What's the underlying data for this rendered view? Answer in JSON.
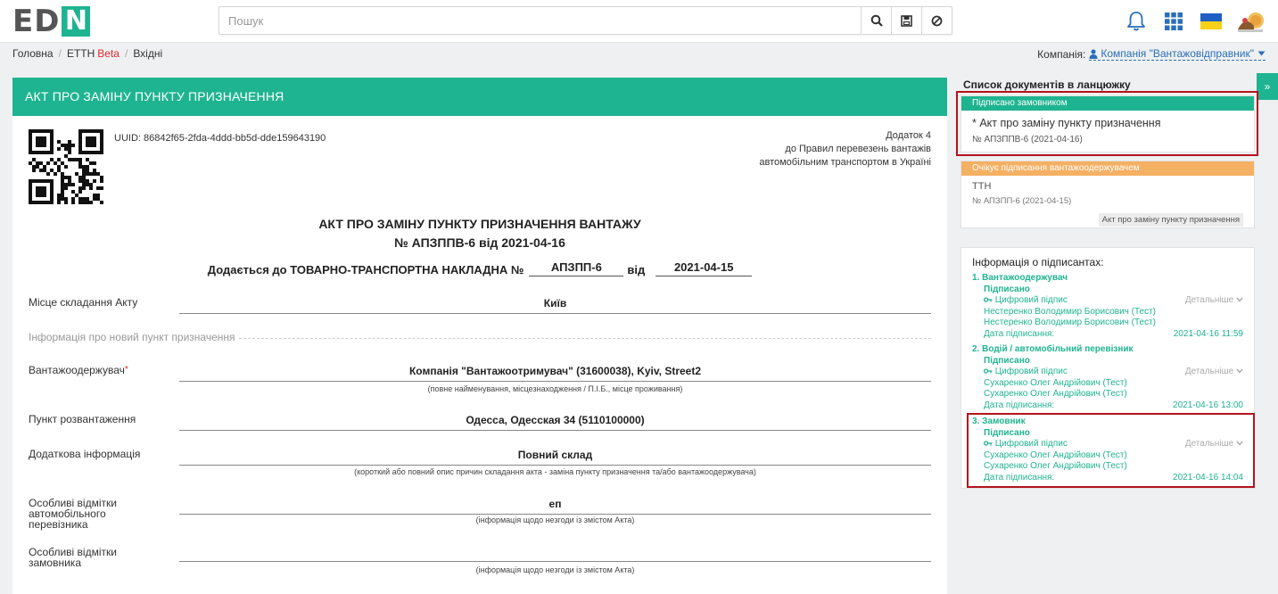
{
  "header": {
    "logo_text": "ED",
    "logo_accent_letter": "N",
    "search_placeholder": "Пошук",
    "icons": [
      "search-icon",
      "save-icon",
      "cancel-icon",
      "bell-icon",
      "apps-grid-icon",
      "ukraine-flag-icon",
      "user-avatar-icon"
    ]
  },
  "breadcrumbs": {
    "home": "Головна",
    "etth": "ЕТТН",
    "beta": "Beta",
    "inbox": "Вхідні"
  },
  "company": {
    "label": "Компанія:",
    "value": "Компанія \"Вантажовідправник\""
  },
  "document": {
    "header_title": "АКТ ПРО ЗАМІНУ ПУНКТУ ПРИЗНАЧЕННЯ",
    "uuid": "UUID: 86842f65-2fda-4ddd-bb5d-dde159643190",
    "addendum": [
      "Додаток 4",
      "до Правил перевезень вантажів",
      "автомобільним транспортом в Україні"
    ],
    "title_line1": "АКТ ПРО ЗАМІНУ ПУНКТУ ПРИЗНАЧЕННЯ ВАНТАЖУ",
    "title_line2": "№ АПЗППВ-6 від 2021-04-16",
    "attach_prefix": "Додається до ТОВАРНО-ТРАНСПОРТНА НАКЛАДНА №",
    "attach_number": "АПЗПП-6",
    "attach_from": "від",
    "attach_date": "2021-04-15",
    "fields": {
      "place_label": "Місце складання Акту",
      "place_value": "Київ",
      "section_new_point": "Інформація про новий пункт призначення",
      "consignee_label": "Вантажоодержувач",
      "consignee_required": "*",
      "consignee_value": "Компанія \"Вантажоотримувач\" (31600038), Kyiv, Street2",
      "consignee_hint": "(повне найменування, місцезнаходження / П.І.Б., місце проживання)",
      "unload_label": "Пункт розвантаження",
      "unload_value": "Одесса, Одесская 34 (5110100000)",
      "extra_label": "Додаткова інформація",
      "extra_value": "Повний склад",
      "extra_hint": "(короткий або повний опис причин складання акта - заміна пункту призначення та/або вантажоодержувача)",
      "carrier_marks_label": "Особливі відмітки автомобільного перевізника",
      "carrier_marks_value": "еп",
      "carrier_marks_hint": "(інформація щодо незгоди із змістом Акта)",
      "customer_marks_label": "Особливі відмітки замовника",
      "customer_marks_value": "",
      "customer_marks_hint": "(інформація щодо незгоди із змістом Акта)"
    }
  },
  "chain": {
    "title": "Список документів в ланцюжку",
    "toggle": "»",
    "items": [
      {
        "status": "Підписано замовником",
        "status_color": "#1fb491",
        "name": "* Акт про заміну пункту призначення",
        "number": "№ АПЗППВ-6 (2021-04-16)",
        "tag": ""
      },
      {
        "status": "Очікує підписання вантажоодержувачем",
        "status_color": "#f4b063",
        "name": "ТТН",
        "number": "№ АПЗПП-6 (2021-04-15)",
        "tag": "Акт про заміну пункту призначення"
      }
    ]
  },
  "signers": {
    "title": "Інформація о підписантах:",
    "list": [
      {
        "num": "1.",
        "role": "Вантажоодержувач",
        "status": "Підписано",
        "sig_type": "Цифровий підпис",
        "details": "Детальніше",
        "name1": "Нестеренко Володимир Борисович (Тест)",
        "name2": "Нестеренко Володимир Борисович (Тест)",
        "date_label": "Дата підписання:",
        "date_value": "2021-04-16 11:59"
      },
      {
        "num": "2.",
        "role": "Водій / автомобільний перевізник",
        "status": "Підписано",
        "sig_type": "Цифровий підпис",
        "details": "Детальніше",
        "name1": "Сухаренко Олег Андрійович (Тест)",
        "name2": "Сухаренко Олег Андрійович (Тест)",
        "date_label": "Дата підписання:",
        "date_value": "2021-04-16 13:00"
      },
      {
        "num": "3.",
        "role": "Замовник",
        "status": "Підписано",
        "sig_type": "Цифровий підпис",
        "details": "Детальніше",
        "name1": "Сухаренко Олег Андрійович (Тест)",
        "name2": "Сухаренко Олег Андрійович (Тест)",
        "date_label": "Дата підписання:",
        "date_value": "2021-04-16 14:04"
      }
    ]
  },
  "colors": {
    "brand": "#1fb491",
    "highlight_border": "#b4131c",
    "link": "#2a6fb8",
    "pending": "#f4b063"
  }
}
